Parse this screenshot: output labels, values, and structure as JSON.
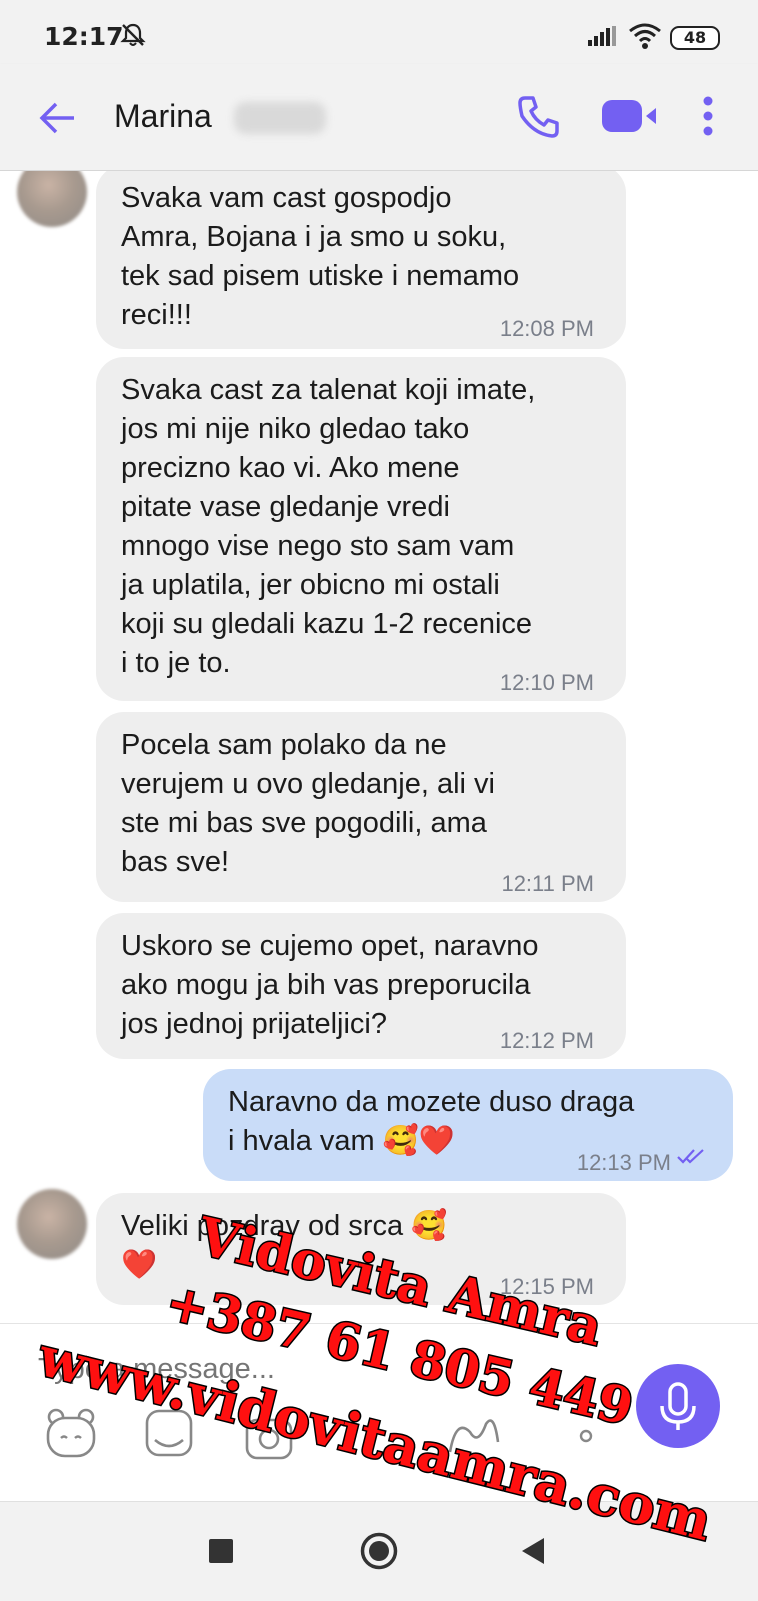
{
  "status_bar": {
    "time": "12:17",
    "battery": "48"
  },
  "header": {
    "contact_name": "Marina"
  },
  "messages": [
    {
      "direction": "in",
      "text": "Svaka vam cast gospodjo\nAmra, Bojana i ja smo u soku,\ntek sad pisem utiske i nemamo\nreci!!!",
      "time": "12:08 PM"
    },
    {
      "direction": "in",
      "text": "Svaka cast za talenat koji imate,\njos mi nije niko gledao tako\nprecizno kao vi. Ako mene\npitate vase gledanje vredi\nmnogo vise nego sto sam vam\nja uplatila, jer obicno mi ostali\nkoji su gledali kazu 1-2 recenice\ni to je to.",
      "time": "12:10 PM"
    },
    {
      "direction": "in",
      "text": "Pocela sam polako da ne\nverujem u ovo gledanje, ali vi\nste mi bas sve pogodili, ama\nbas sve!",
      "time": "12:11 PM"
    },
    {
      "direction": "in",
      "text": "Uskoro se cujemo opet, naravno\nako mogu ja bih vas preporucila\njos jednoj prijateljici?",
      "time": "12:12 PM"
    },
    {
      "direction": "out",
      "text": "Naravno da mozete duso draga\ni hvala vam 🥰❤️",
      "time": "12:13 PM"
    },
    {
      "direction": "in",
      "text": "Veliki pozdrav od srca 🥰\n❤️",
      "time": "12:15 PM"
    }
  ],
  "composer": {
    "placeholder": "Type a message..."
  },
  "watermark": {
    "line1": "Vidovita Amra",
    "line2": "+387 61 805 449",
    "line3": "www.vidovitaamra.com"
  },
  "colors": {
    "accent": "#7360f2",
    "incoming_bubble": "#eeeeee",
    "outgoing_bubble": "#c9dcf8",
    "watermark": "#ff1010"
  }
}
